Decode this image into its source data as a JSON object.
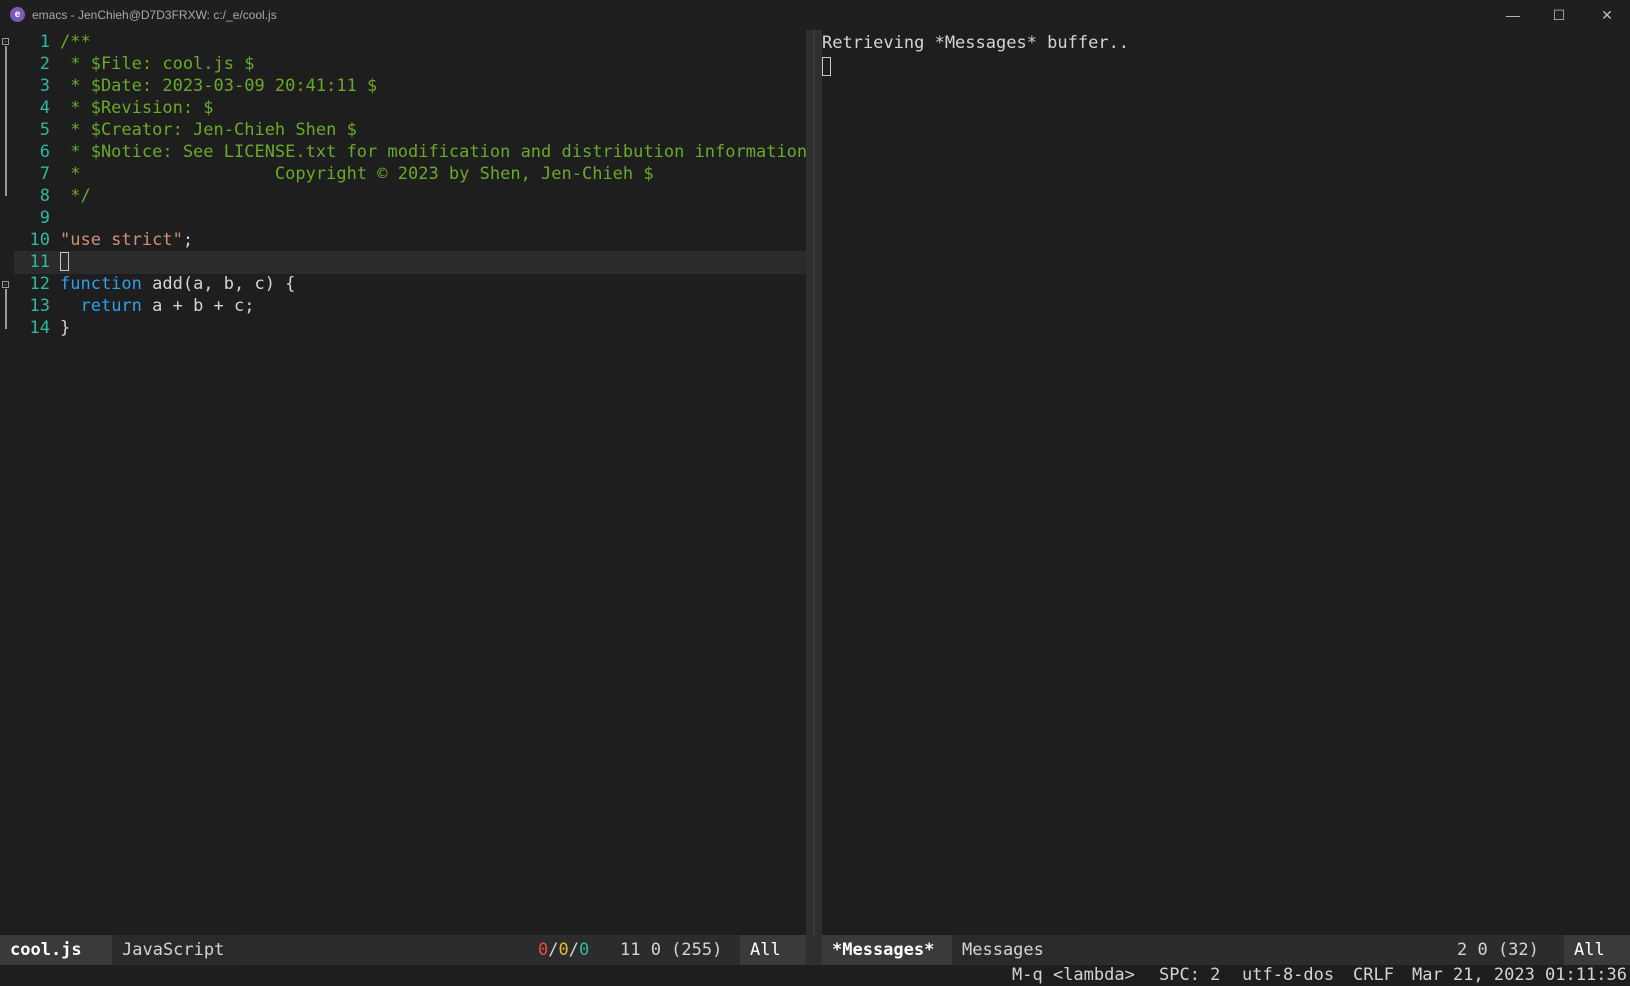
{
  "window": {
    "title": "emacs - JenChieh@D7D3FRXW: c:/_e/cool.js",
    "buttons": {
      "minimize": "—",
      "maximize": "☐",
      "close": "✕"
    }
  },
  "left_pane": {
    "lines": [
      {
        "num": "1",
        "text": "/**",
        "class": "c-comment"
      },
      {
        "num": "2",
        "text": " * $File: cool.js $",
        "class": "c-comment"
      },
      {
        "num": "3",
        "text": " * $Date: 2023-03-09 20:41:11 $",
        "class": "c-comment"
      },
      {
        "num": "4",
        "text": " * $Revision: $",
        "class": "c-comment"
      },
      {
        "num": "5",
        "text": " * $Creator: Jen-Chieh Shen $",
        "class": "c-comment"
      },
      {
        "num": "6",
        "text": " * $Notice: See LICENSE.txt for modification and distribution information",
        "class": "c-comment"
      },
      {
        "num": "7",
        "text": " *                   Copyright © 2023 by Shen, Jen-Chieh $",
        "class": "c-comment"
      },
      {
        "num": "8",
        "text": " */",
        "class": "c-comment"
      },
      {
        "num": "9",
        "text": "",
        "class": "c-plain"
      },
      {
        "num": "10",
        "parts": [
          {
            "t": "\"use strict\"",
            "c": "c-str"
          },
          {
            "t": ";",
            "c": "c-plain"
          }
        ]
      },
      {
        "num": "11",
        "text": "",
        "class": "c-plain",
        "cursor": true,
        "highlight": true
      },
      {
        "num": "12",
        "parts": [
          {
            "t": "function",
            "c": "c-kw"
          },
          {
            "t": " add(a, b, c) {",
            "c": "c-plain"
          }
        ]
      },
      {
        "num": "13",
        "parts": [
          {
            "t": "  ",
            "c": "c-plain"
          },
          {
            "t": "return",
            "c": "c-kw"
          },
          {
            "t": " a + b + c;",
            "c": "c-plain"
          }
        ]
      },
      {
        "num": "14",
        "text": "}",
        "class": "c-plain"
      }
    ]
  },
  "right_pane": {
    "message": "Retrieving *Messages* buffer.."
  },
  "left_modeline": {
    "buffer": "cool.js",
    "mode": "JavaScript",
    "err": "0",
    "warn": "0",
    "info": "0",
    "sep": "/",
    "position": "11 0 (255)",
    "scroll": "All"
  },
  "right_modeline": {
    "buffer": "*Messages*",
    "mode": "Messages",
    "position": "2 0 (32)",
    "scroll": "All"
  },
  "echo_area": {
    "keybind": "M-q <lambda>",
    "indent": "SPC: 2",
    "encoding": "utf-8-dos",
    "eol": "CRLF",
    "datetime": "Mar 21, 2023 01:11:36"
  },
  "colors": {
    "error": "#e74c3c",
    "warning": "#e8b931",
    "info": "#2fb8a0"
  }
}
